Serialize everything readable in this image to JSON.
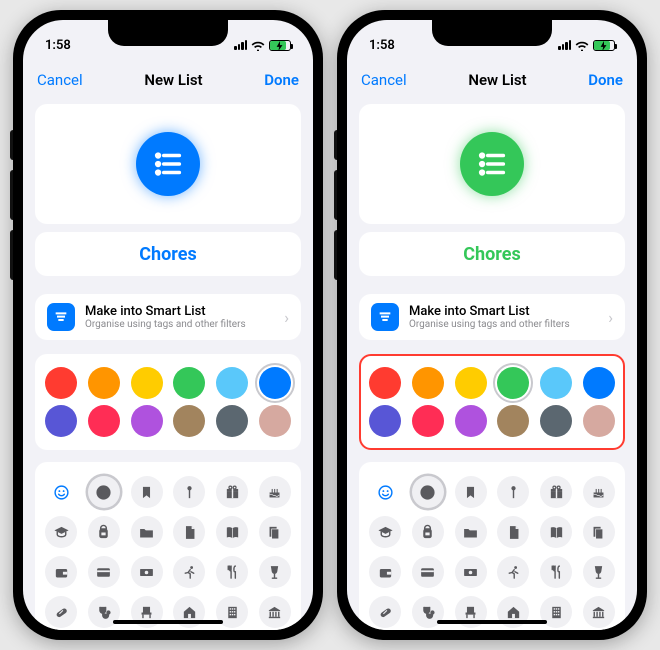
{
  "status": {
    "time": "1:58"
  },
  "nav": {
    "cancel": "Cancel",
    "title": "New List",
    "done": "Done"
  },
  "list_name": "Chores",
  "smart_list": {
    "title": "Make into Smart List",
    "subtitle": "Organise using tags and other filters"
  },
  "colors_row1": [
    "#ff3b30",
    "#ff9500",
    "#ffcc00",
    "#34c759",
    "#5ac8fa",
    "#007aff"
  ],
  "colors_row2": [
    "#5856d6",
    "#ff2d55",
    "#af52de",
    "#a2845e",
    "#5b6770",
    "#d6a9a0"
  ],
  "left_selected_color_index": 5,
  "right_selected_color_index": 3,
  "icons": {
    "row1": [
      "emoji",
      "list",
      "bookmark",
      "pin",
      "gift",
      "cake"
    ],
    "row2": [
      "grad",
      "backpack",
      "folder",
      "doc",
      "book",
      "pages"
    ],
    "row3": [
      "wallet",
      "card",
      "cash",
      "run",
      "fork",
      "wine"
    ],
    "row4": [
      "pill",
      "steth",
      "chair",
      "house",
      "building",
      "museum"
    ]
  },
  "selected_icon": "list"
}
